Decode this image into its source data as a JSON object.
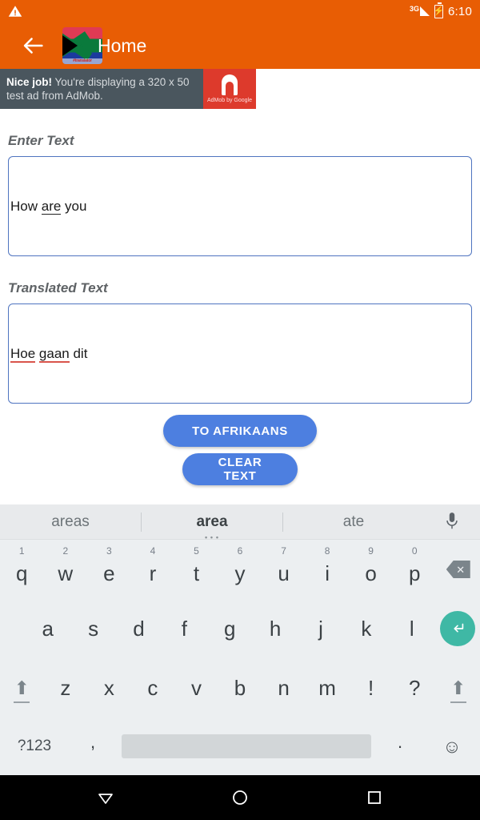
{
  "status_bar": {
    "warning_icon": "warning-triangle-icon",
    "network": "3G",
    "battery_icon": "battery-charging-icon",
    "time": "6:10"
  },
  "app_bar": {
    "back_icon": "back-arrow-icon",
    "app_icon": "south-africa-flag-icon",
    "app_icon_caption": "#translator",
    "title": "Home",
    "background_color": "#e85d04"
  },
  "ad": {
    "headline": "Nice job!",
    "body": " You're displaying a 320 x 50 test ad from AdMob.",
    "logo_label": "AdMob by Google",
    "logo_color": "#dd3a2c",
    "panel_color": "#4a565e"
  },
  "form": {
    "input": {
      "label": "Enter Text",
      "value_parts": [
        {
          "text": "How ",
          "underline": "none"
        },
        {
          "text": "are",
          "underline": "black"
        },
        {
          "text": " you",
          "underline": "none"
        }
      ],
      "value": "How are you",
      "border_color": "#4f74c0"
    },
    "output": {
      "label": "Translated Text",
      "value_parts": [
        {
          "text": "Hoe",
          "underline": "red"
        },
        {
          "text": " ",
          "underline": "none"
        },
        {
          "text": "gaan",
          "underline": "red"
        },
        {
          "text": " dit",
          "underline": "none"
        }
      ],
      "value": "Hoe gaan dit",
      "border_color": "#4f74c0"
    }
  },
  "buttons": {
    "translate_label": "TO AFRIKAANS",
    "clear_label": "CLEAR TEXT",
    "color": "#4d7fe0"
  },
  "keyboard": {
    "suggestions": [
      {
        "text": "areas",
        "selected": false
      },
      {
        "text": "area",
        "selected": true
      },
      {
        "text": "ate",
        "selected": false
      }
    ],
    "mic_icon": "microphone-icon",
    "row1": [
      {
        "key": "q",
        "num": "1"
      },
      {
        "key": "w",
        "num": "2"
      },
      {
        "key": "e",
        "num": "3"
      },
      {
        "key": "r",
        "num": "4"
      },
      {
        "key": "t",
        "num": "5"
      },
      {
        "key": "y",
        "num": "6"
      },
      {
        "key": "u",
        "num": "7"
      },
      {
        "key": "i",
        "num": "8"
      },
      {
        "key": "o",
        "num": "9"
      },
      {
        "key": "p",
        "num": "0"
      }
    ],
    "backspace_icon": "backspace-icon",
    "row2": [
      "a",
      "s",
      "d",
      "f",
      "g",
      "h",
      "j",
      "k",
      "l"
    ],
    "enter_icon": "enter-key-icon",
    "enter_color": "#3fb8a5",
    "row3": [
      "z",
      "x",
      "c",
      "v",
      "b",
      "n",
      "m",
      "!",
      "?"
    ],
    "shift_icon": "shift-icon",
    "row4": {
      "symbols_label": "?123",
      "comma": ",",
      "space": "",
      "period": ".",
      "emoji_icon": "emoji-icon"
    },
    "background_color": "#eceff1",
    "space_color": "#d2d6d8"
  },
  "nav_bar": {
    "back_icon": "nav-back-triangle-icon",
    "home_icon": "nav-home-circle-icon",
    "recents_icon": "nav-recents-square-icon"
  }
}
